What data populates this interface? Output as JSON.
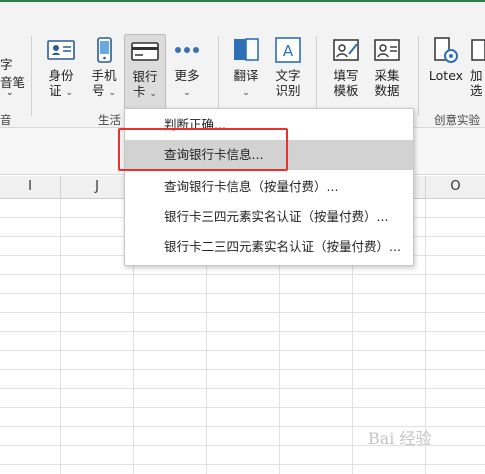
{
  "ribbon": {
    "left_partial": {
      "line1": "字",
      "line2": "音笔",
      "group": "音"
    },
    "buttons": {
      "id_card": {
        "line1": "身份",
        "line2": "证"
      },
      "phone": {
        "line1": "手机",
        "line2": "号"
      },
      "bank_card": {
        "line1": "银行",
        "line2": "卡"
      },
      "more": {
        "line1": "更多"
      },
      "translate": {
        "line1": "翻译"
      },
      "ocr": {
        "line1": "文字",
        "line2": "识别"
      },
      "fill_template": {
        "line1": "填写",
        "line2": "模板"
      },
      "collect": {
        "line1": "采集",
        "line2": "数据"
      },
      "lotex": {
        "line1": "Lotex"
      },
      "add_partial": {
        "line1": "加",
        "line2": "选"
      }
    },
    "groups": {
      "life": "生活",
      "creative": "创意实验"
    }
  },
  "columns": [
    "I",
    "J",
    "O"
  ],
  "dropdown": {
    "items": [
      "判断正确...",
      "查询银行卡信息...",
      "查询银行卡信息（按量付费）...",
      "银行卡三四元素实名认证（按量付费）...",
      "银行卡二三四元素实名认证（按量付费）..."
    ],
    "highlighted_index": 1
  },
  "watermark": "Bai 经验",
  "colors": {
    "accent_green": "#2f7d4f",
    "highlight_red": "#e8322f"
  }
}
